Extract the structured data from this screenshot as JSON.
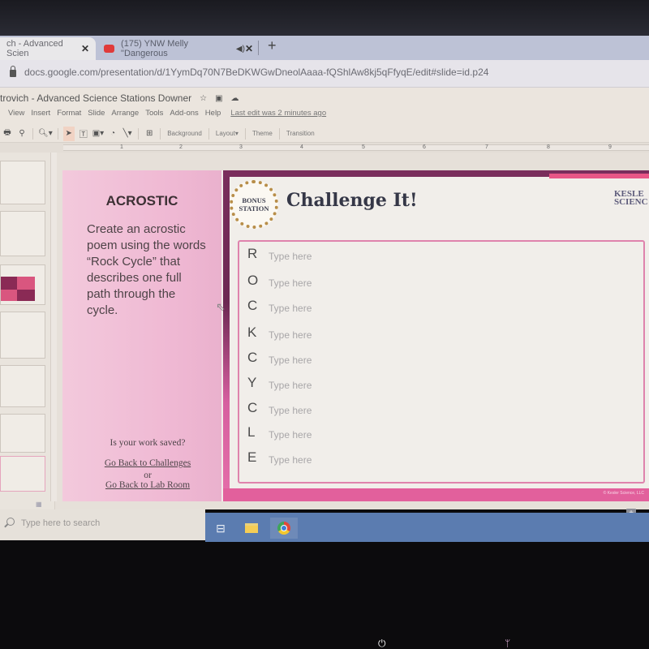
{
  "browser": {
    "tabs": [
      {
        "label": "ch - Advanced Scien",
        "active": true,
        "close_icon": "close-icon"
      },
      {
        "label": "(175) YNW Melly \"Dangerous",
        "active": false,
        "favicon": "youtube-icon",
        "audio_icon": "speaker-icon",
        "close_icon": "close-icon"
      }
    ],
    "new_tab": "+",
    "url": "docs.google.com/presentation/d/1YymDq70N7BeDKWGwDneolAaaa-fQShlAw8kj5qFfyqE/edit#slide=id.p24"
  },
  "docs": {
    "title": "trovich - Advanced Science Stations Downer",
    "title_icons": [
      "star-icon",
      "folder-icon",
      "cloud-icon"
    ],
    "menu": [
      "View",
      "Insert",
      "Format",
      "Slide",
      "Arrange",
      "Tools",
      "Add-ons",
      "Help"
    ],
    "last_edit": "Last edit was 2 minutes ago",
    "toolbar": {
      "icons": [
        "print-icon",
        "paint-format-icon",
        "zoom-icon",
        "select-icon",
        "textbox-icon",
        "image-icon",
        "shape-icon",
        "line-icon",
        "comment-icon"
      ],
      "background": "Background",
      "layout": "Layout",
      "theme": "Theme",
      "transition": "Transition"
    },
    "ruler_labels": [
      "1",
      "2",
      "3",
      "4",
      "5",
      "6",
      "7",
      "8",
      "9"
    ]
  },
  "slide": {
    "left": {
      "title": "ACROSTIC",
      "description": "Create an acrostic poem using the words “Rock Cycle” that describes one full path through the cycle.",
      "saved_prompt": "Is your work saved?",
      "link_challenges": "Go Back to Challenges",
      "or": "or",
      "link_lab": "Go Back to Lab Room"
    },
    "badge": {
      "line1": "BONUS",
      "line2": "STATION"
    },
    "title": "Challenge It!",
    "logo": {
      "line1": "KESLE",
      "line2": "SCIENC"
    },
    "copyright": "© Kesler Science, LLC",
    "rows": [
      {
        "letter": "R",
        "placeholder": "Type here"
      },
      {
        "letter": "O",
        "placeholder": "Type here"
      },
      {
        "letter": "C",
        "placeholder": "Type here"
      },
      {
        "letter": "K",
        "placeholder": "Type here"
      },
      {
        "letter": "C",
        "placeholder": "Type here"
      },
      {
        "letter": "Y",
        "placeholder": "Type here"
      },
      {
        "letter": "C",
        "placeholder": "Type here"
      },
      {
        "letter": "L",
        "placeholder": "Type here"
      },
      {
        "letter": "E",
        "placeholder": "Type here"
      }
    ],
    "colors": {
      "frame": "#7a2d5c",
      "accent_pink": "#e2609c",
      "panel_pink": "#efb8d3"
    }
  },
  "taskbar": {
    "search_placeholder": "Type here to search",
    "apps": [
      "task-view-icon",
      "file-explorer-icon",
      "chrome-icon"
    ]
  }
}
